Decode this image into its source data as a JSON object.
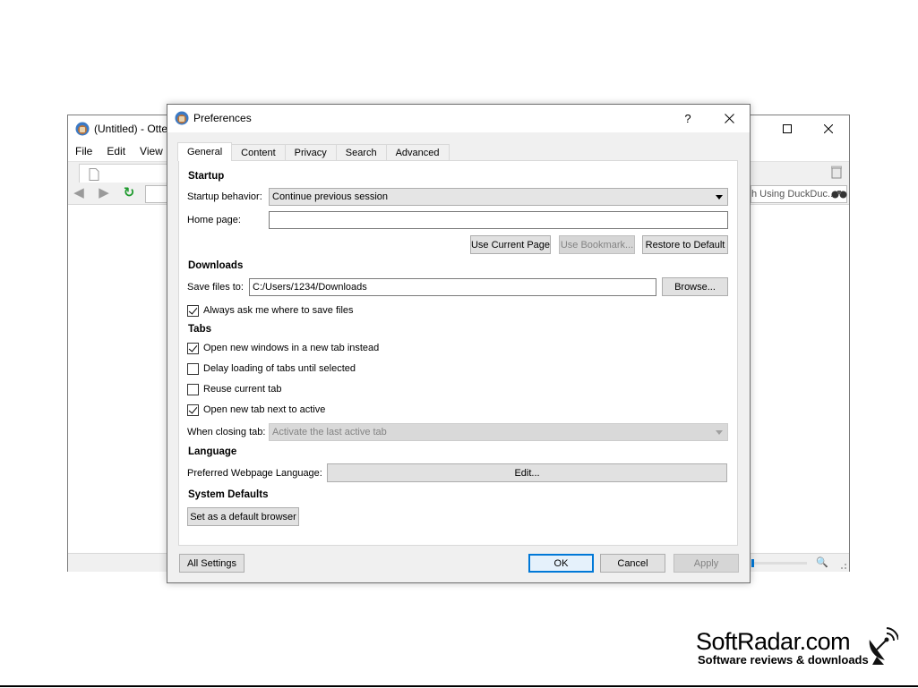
{
  "background_window": {
    "title": "(Untitled) - Otte",
    "menu": [
      "File",
      "Edit",
      "View"
    ],
    "search_placeholder": "h Using DuckDuc..."
  },
  "dialog": {
    "title": "Preferences",
    "help_label": "?",
    "tabs": [
      "General",
      "Content",
      "Privacy",
      "Search",
      "Advanced"
    ],
    "active_tab": "General",
    "startup": {
      "heading": "Startup",
      "behavior_label": "Startup behavior:",
      "behavior_value": "Continue previous session",
      "home_label": "Home page:",
      "home_value": "",
      "use_current_page": "Use Current Page",
      "use_bookmark": "Use Bookmark...",
      "restore_default": "Restore to Default"
    },
    "downloads": {
      "heading": "Downloads",
      "save_label": "Save files to:",
      "save_path": "C:/Users/1234/Downloads",
      "browse": "Browse...",
      "always_ask": "Always ask me where to save files",
      "always_ask_checked": true
    },
    "tabs_section": {
      "heading": "Tabs",
      "options": [
        {
          "label": "Open new windows in a new tab instead",
          "checked": true
        },
        {
          "label": "Delay loading of tabs until selected",
          "checked": false
        },
        {
          "label": "Reuse current tab",
          "checked": false
        },
        {
          "label": "Open new tab next to active",
          "checked": true
        }
      ],
      "closing_label": "When closing tab:",
      "closing_value": "Activate the last active tab"
    },
    "language": {
      "heading": "Language",
      "preferred_label": "Preferred Webpage Language:",
      "edit": "Edit..."
    },
    "system_defaults": {
      "heading": "System Defaults",
      "set_default": "Set as a default browser"
    },
    "footer": {
      "all_settings": "All Settings",
      "ok": "OK",
      "cancel": "Cancel",
      "apply": "Apply"
    }
  },
  "watermark": {
    "brand": "SoftRadar.com",
    "tagline": "Software reviews & downloads"
  },
  "colors": {
    "accent": "#0078d7",
    "dialog_bg": "#f0f0f0",
    "panel_bg": "#ffffff"
  }
}
